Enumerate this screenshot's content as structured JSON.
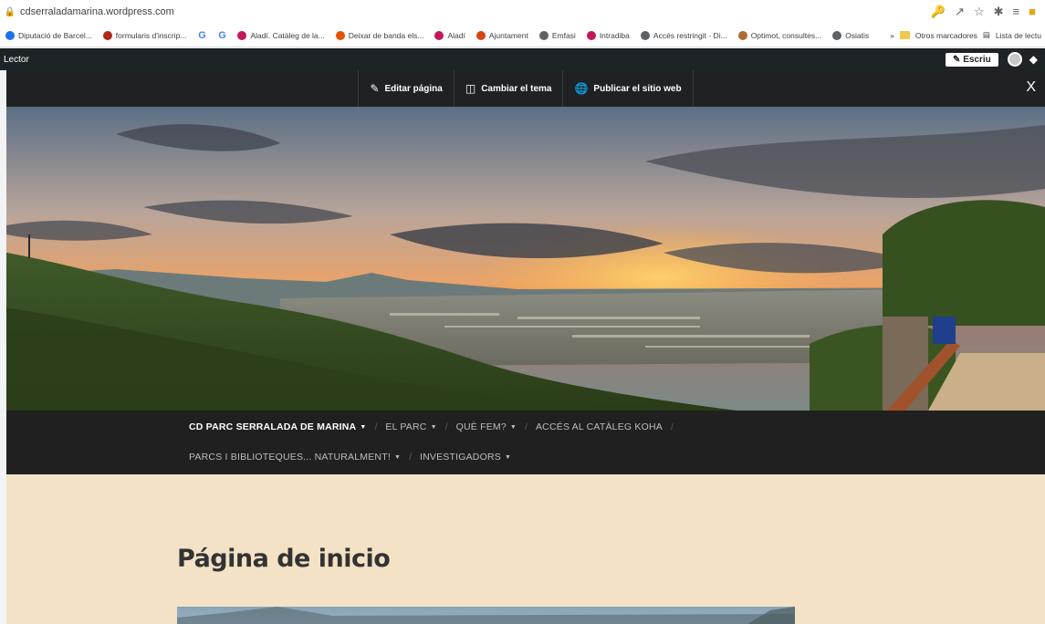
{
  "browser": {
    "url": "cdserraladamarina.wordpress.com",
    "bookmarks": [
      {
        "label": "Diputació de Barcel...",
        "icon": "diputacio-icon",
        "color": "#1a73e8"
      },
      {
        "label": "formularis d'inscrip...",
        "icon": "bookmark-icon",
        "color": "#b3261e"
      },
      {
        "label": "",
        "icon": "google-icon",
        "color": "#4285f4"
      },
      {
        "label": "",
        "icon": "google-icon",
        "color": "#4285f4"
      },
      {
        "label": "Aladí. Catàleg de la...",
        "icon": "aladi-icon",
        "color": "#c2185b"
      },
      {
        "label": "Deixar de banda els...",
        "icon": "pen-icon",
        "color": "#e65100"
      },
      {
        "label": "Aladí",
        "icon": "aladi-icon",
        "color": "#c2185b"
      },
      {
        "label": "Ajuntament",
        "icon": "ajuntament-icon",
        "color": "#d84315"
      },
      {
        "label": "Emfasi",
        "icon": "globe-icon",
        "color": "#5f6368"
      },
      {
        "label": "Intradiba",
        "icon": "intradiba-icon",
        "color": "#c2185b"
      },
      {
        "label": "Accés restringit - Di...",
        "icon": "globe-icon",
        "color": "#5f6368"
      },
      {
        "label": "Optimot, consultes...",
        "icon": "optimot-icon",
        "color": "#ad6b2f"
      },
      {
        "label": "Osiatis",
        "icon": "globe-icon",
        "color": "#5f6368"
      }
    ],
    "more": "»",
    "other_bookmarks": "Otros marcadores",
    "reading_list": "Lista de lectu"
  },
  "wpbar": {
    "lector": "Lector",
    "write": "Escriu"
  },
  "editbar": {
    "edit_page": "Editar página",
    "change_theme": "Cambiar el tema",
    "publish": "Publicar el sitio web",
    "close": "X"
  },
  "nav": {
    "row1": [
      {
        "label": "CD PARC SERRALADA DE MARINA",
        "dropdown": true,
        "active": true
      },
      {
        "label": "EL PARC",
        "dropdown": true,
        "active": false
      },
      {
        "label": "QUÈ FEM?",
        "dropdown": true,
        "active": false
      },
      {
        "label": "ACCÉS AL CATÀLEG KOHA",
        "dropdown": false,
        "active": false
      }
    ],
    "row2": [
      {
        "label": "PARCS I BIBLIOTEQUES... NATURALMENT!",
        "dropdown": true,
        "active": false
      },
      {
        "label": "INVESTIGADORS",
        "dropdown": true,
        "active": false
      }
    ]
  },
  "main": {
    "title": "Página de inicio"
  },
  "colors": {
    "page_background": "#f3e2c6",
    "nav_background": "#202020",
    "admin_bar": "#1d2327"
  }
}
